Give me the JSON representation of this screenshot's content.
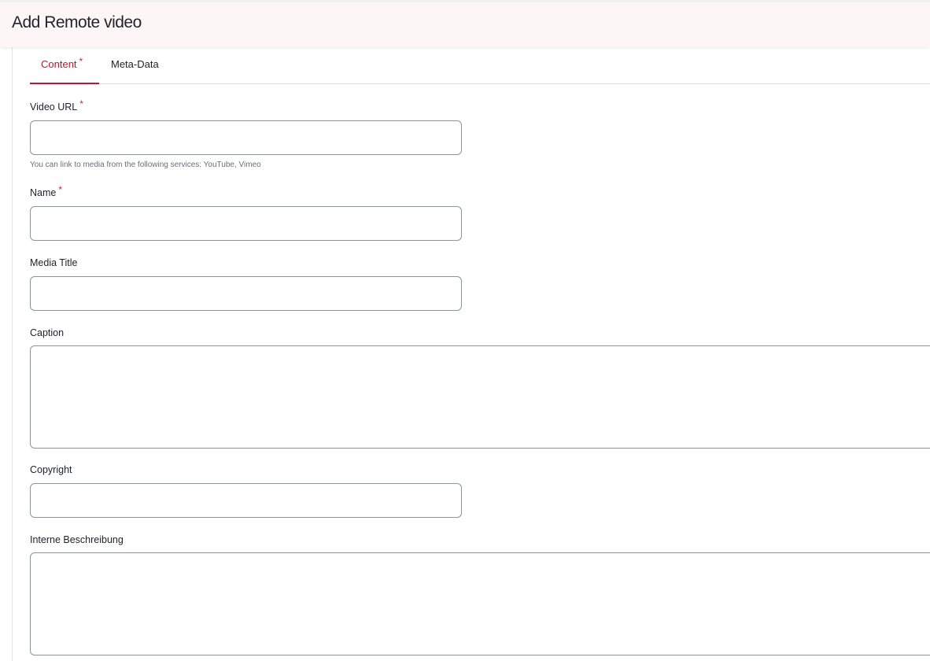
{
  "header": {
    "title": "Add Remote video"
  },
  "tabs": [
    {
      "label": "Content",
      "active": true,
      "required_marker": "*"
    },
    {
      "label": "Meta-Data",
      "active": false
    }
  ],
  "form": {
    "video_url": {
      "label": "Video URL",
      "required_marker": "*",
      "value": "",
      "help": "You can link to media from the following services: YouTube, Vimeo"
    },
    "name": {
      "label": "Name",
      "required_marker": "*",
      "value": ""
    },
    "media_title": {
      "label": "Media Title",
      "value": ""
    },
    "caption": {
      "label": "Caption",
      "value": ""
    },
    "copyright": {
      "label": "Copyright",
      "value": ""
    },
    "internal_description": {
      "label": "Interne Beschreibung",
      "value": ""
    }
  },
  "colors": {
    "accent": "#c8102e",
    "required": "#d3213c",
    "header_bg": "#fcf6f6",
    "input_border": "#8e929c"
  }
}
